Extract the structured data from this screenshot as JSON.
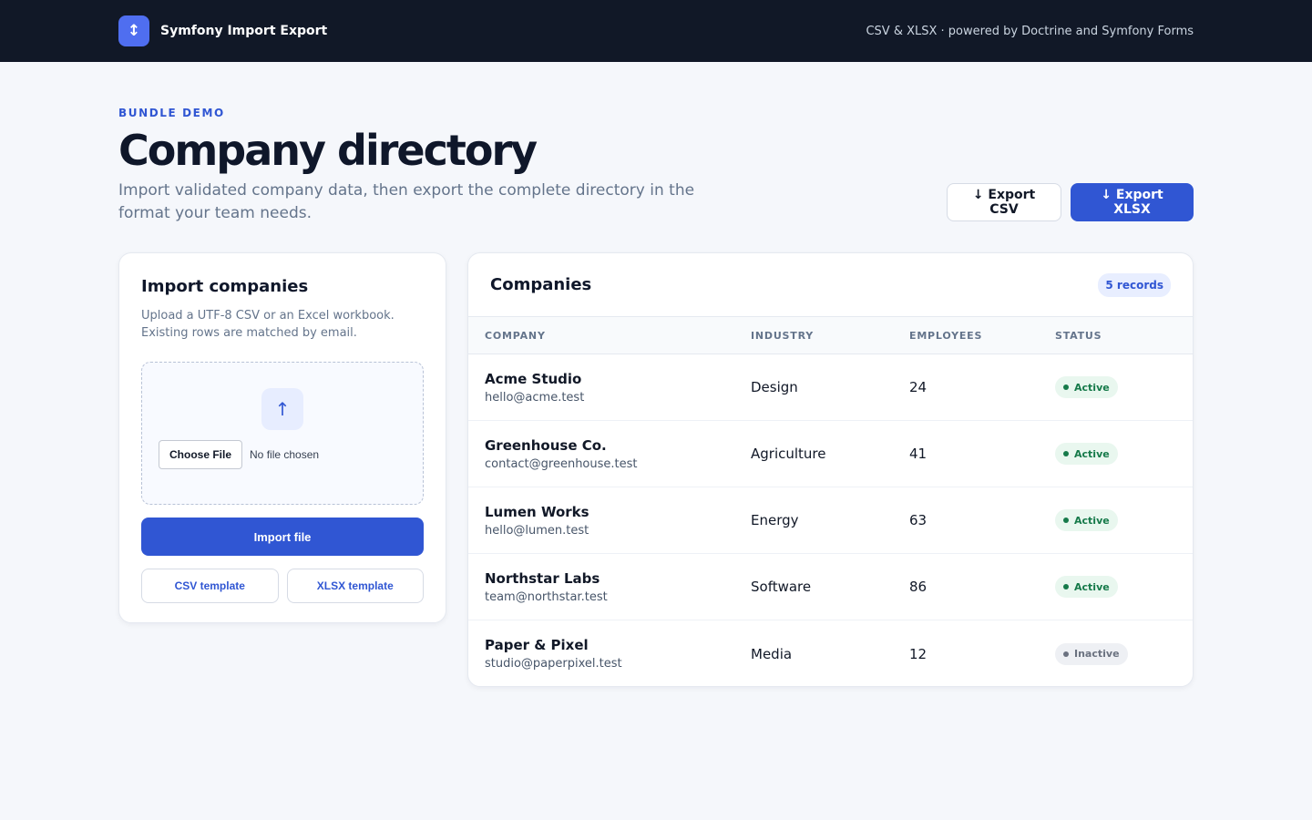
{
  "header": {
    "logo_glyph": "↕",
    "brand": "Symfony Import Export",
    "meta": "CSV & XLSX · powered by Doctrine and Symfony Forms"
  },
  "hero": {
    "eyebrow": "BUNDLE DEMO",
    "title": "Company directory",
    "subtitle": "Import validated company data, then export the complete directory in the format your team needs.",
    "export_csv": "↓ Export CSV",
    "export_xlsx": "↓ Export XLSX"
  },
  "import": {
    "title": "Import companies",
    "description": "Upload a UTF-8 CSV or an Excel workbook. Existing rows are matched by email.",
    "upload_glyph": "↑",
    "choose_file": "Choose File",
    "no_file": "No file chosen",
    "import_button": "Import file",
    "csv_template": "CSV template",
    "xlsx_template": "XLSX template"
  },
  "companies": {
    "title": "Companies",
    "records": "5 records",
    "columns": [
      "COMPANY",
      "INDUSTRY",
      "EMPLOYEES",
      "STATUS"
    ],
    "rows": [
      {
        "name": "Acme Studio",
        "email": "hello@acme.test",
        "industry": "Design",
        "employees": "24",
        "status": "Active"
      },
      {
        "name": "Greenhouse Co.",
        "email": "contact@greenhouse.test",
        "industry": "Agriculture",
        "employees": "41",
        "status": "Active"
      },
      {
        "name": "Lumen Works",
        "email": "hello@lumen.test",
        "industry": "Energy",
        "employees": "63",
        "status": "Active"
      },
      {
        "name": "Northstar Labs",
        "email": "team@northstar.test",
        "industry": "Software",
        "employees": "86",
        "status": "Active"
      },
      {
        "name": "Paper & Pixel",
        "email": "studio@paperpixel.test",
        "industry": "Media",
        "employees": "12",
        "status": "Inactive"
      }
    ]
  },
  "colors": {
    "accent": "#3056d3",
    "header_bg": "#111827",
    "active_text": "#167a4a",
    "inactive_text": "#6b7280"
  },
  "icons": {
    "logo": "arrows-up-down-icon",
    "upload": "upload-arrow-icon",
    "export": "download-arrow-icon"
  }
}
